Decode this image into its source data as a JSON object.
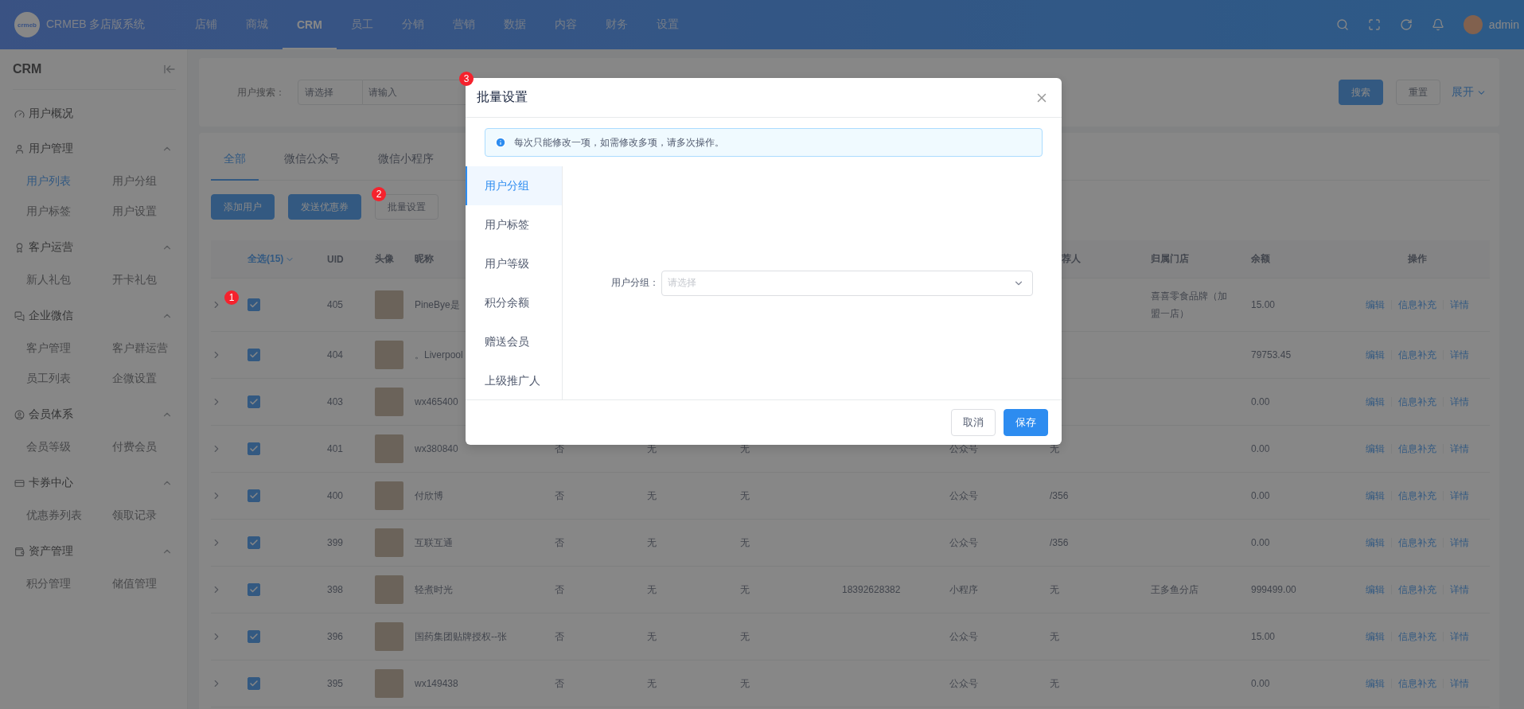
{
  "topbar": {
    "logo_text": "crmeb",
    "brand": "CRMEB 多店版系统",
    "nav": [
      {
        "label": "店铺",
        "selected": false
      },
      {
        "label": "商城",
        "selected": false
      },
      {
        "label": "CRM",
        "selected": true
      },
      {
        "label": "员工",
        "selected": false
      },
      {
        "label": "分销",
        "selected": false
      },
      {
        "label": "营销",
        "selected": false
      },
      {
        "label": "数据",
        "selected": false
      },
      {
        "label": "内容",
        "selected": false
      },
      {
        "label": "财务",
        "selected": false
      },
      {
        "label": "设置",
        "selected": false
      }
    ],
    "user": "admin"
  },
  "sidebar": {
    "title": "CRM",
    "items": [
      {
        "label": "用户概况"
      },
      {
        "label": "用户管理",
        "expanded": true,
        "children": [
          {
            "label": "用户列表",
            "selected": true
          },
          {
            "label": "用户分组",
            "selected": false
          },
          {
            "label": "用户标签",
            "selected": false
          },
          {
            "label": "用户设置",
            "selected": false
          }
        ]
      },
      {
        "label": "客户运营",
        "expanded": true,
        "children": [
          {
            "label": "新人礼包",
            "selected": false
          },
          {
            "label": "开卡礼包",
            "selected": false
          }
        ]
      },
      {
        "label": "企业微信",
        "expanded": true,
        "children": [
          {
            "label": "客户管理",
            "selected": false
          },
          {
            "label": "客户群运营",
            "selected": false
          },
          {
            "label": "员工列表",
            "selected": false
          },
          {
            "label": "企微设置",
            "selected": false
          }
        ]
      },
      {
        "label": "会员体系",
        "expanded": true,
        "children": [
          {
            "label": "会员等级",
            "selected": false
          },
          {
            "label": "付费会员",
            "selected": false
          }
        ]
      },
      {
        "label": "卡券中心",
        "expanded": true,
        "children": [
          {
            "label": "优惠券列表",
            "selected": false
          },
          {
            "label": "领取记录",
            "selected": false
          }
        ]
      },
      {
        "label": "资产管理",
        "expanded": true,
        "children": [
          {
            "label": "积分管理",
            "selected": false
          },
          {
            "label": "储值管理",
            "selected": false
          }
        ]
      }
    ]
  },
  "search": {
    "label": "用户搜索：",
    "select_placeholder": "请选择",
    "input_placeholder": "请输入",
    "search_button": "搜索",
    "reset_button": "重置",
    "expand_link": "展开"
  },
  "tabs": [
    {
      "label": "全部",
      "selected": true
    },
    {
      "label": "微信公众号",
      "selected": false
    },
    {
      "label": "微信小程序",
      "selected": false
    }
  ],
  "toolbar": [
    {
      "label": "添加用户",
      "kind": "primary"
    },
    {
      "label": "发送优惠券",
      "kind": "primary"
    },
    {
      "label": "批量设置",
      "kind": "outline",
      "marker": "2"
    }
  ],
  "table": {
    "columns": {
      "select": "全选(15)",
      "uid": "UID",
      "avatar": "头像",
      "nickname": "昵称",
      "referrer": "荐人",
      "store": "归属门店",
      "balance": "余额",
      "actions": "操作"
    },
    "rows": [
      {
        "marker": "1",
        "checked": true,
        "uid": "405",
        "nickname": "PineBye是",
        "store": "喜喜零食品牌（加盟一店）",
        "balance": "15.00",
        "actions": [
          "编辑",
          "信息补充",
          "详情"
        ]
      },
      {
        "checked": true,
        "uid": "404",
        "nickname": "。Liverpool",
        "balance": "79753.45",
        "actions": [
          "编辑",
          "信息补充",
          "详情"
        ]
      },
      {
        "checked": true,
        "uid": "403",
        "nickname": "wx465400",
        "balance": "0.00",
        "actions": [
          "编辑",
          "信息补充",
          "详情"
        ]
      },
      {
        "checked": true,
        "uid": "401",
        "nickname": "wx380840",
        "column_6": "否",
        "column_7": "无",
        "column_8": "无",
        "column_10": "公众号",
        "referrer": "无",
        "balance": "0.00",
        "actions": [
          "编辑",
          "信息补充",
          "详情"
        ]
      },
      {
        "checked": true,
        "uid": "400",
        "nickname": "付欣博",
        "column_6": "否",
        "column_7": "无",
        "column_8": "无",
        "column_10": "公众号",
        "referrer": "/356",
        "balance": "0.00",
        "actions": [
          "编辑",
          "信息补充",
          "详情"
        ]
      },
      {
        "checked": true,
        "uid": "399",
        "nickname": "互联互通",
        "column_6": "否",
        "column_7": "无",
        "column_8": "无",
        "column_10": "公众号",
        "referrer": "/356",
        "balance": "0.00",
        "actions": [
          "编辑",
          "信息补充",
          "详情"
        ]
      },
      {
        "checked": true,
        "uid": "398",
        "nickname": "轻煮时光",
        "column_6": "否",
        "column_7": "无",
        "column_8": "无",
        "column_9": "18392628382",
        "column_10": "小程序",
        "referrer": "无",
        "store": "王多鱼分店",
        "balance": "999499.00",
        "actions": [
          "编辑",
          "信息补充",
          "详情"
        ]
      },
      {
        "checked": true,
        "uid": "396",
        "nickname": "国药集团贴牌授权--张",
        "column_6": "否",
        "column_7": "无",
        "column_8": "无",
        "column_10": "公众号",
        "referrer": "无",
        "balance": "15.00",
        "actions": [
          "编辑",
          "信息补充",
          "详情"
        ]
      },
      {
        "checked": true,
        "uid": "395",
        "nickname": "wx149438",
        "column_6": "否",
        "column_7": "无",
        "column_8": "无",
        "column_10": "公众号",
        "referrer": "无",
        "balance": "0.00",
        "actions": [
          "编辑",
          "信息补充",
          "详情"
        ]
      }
    ]
  },
  "modal": {
    "marker": "3",
    "title": "批量设置",
    "notice": "每次只能修改一项，如需修改多项，请多次操作。",
    "tabs": [
      {
        "label": "用户分组",
        "selected": true
      },
      {
        "label": "用户标签",
        "selected": false
      },
      {
        "label": "用户等级",
        "selected": false
      },
      {
        "label": "积分余额",
        "selected": false
      },
      {
        "label": "赠送会员",
        "selected": false
      },
      {
        "label": "上级推广人",
        "selected": false
      }
    ],
    "field": {
      "label": "用户分组：",
      "placeholder": "请选择"
    },
    "buttons": [
      {
        "label": "取消",
        "kind": "default"
      },
      {
        "label": "保存",
        "kind": "primary"
      }
    ]
  }
}
